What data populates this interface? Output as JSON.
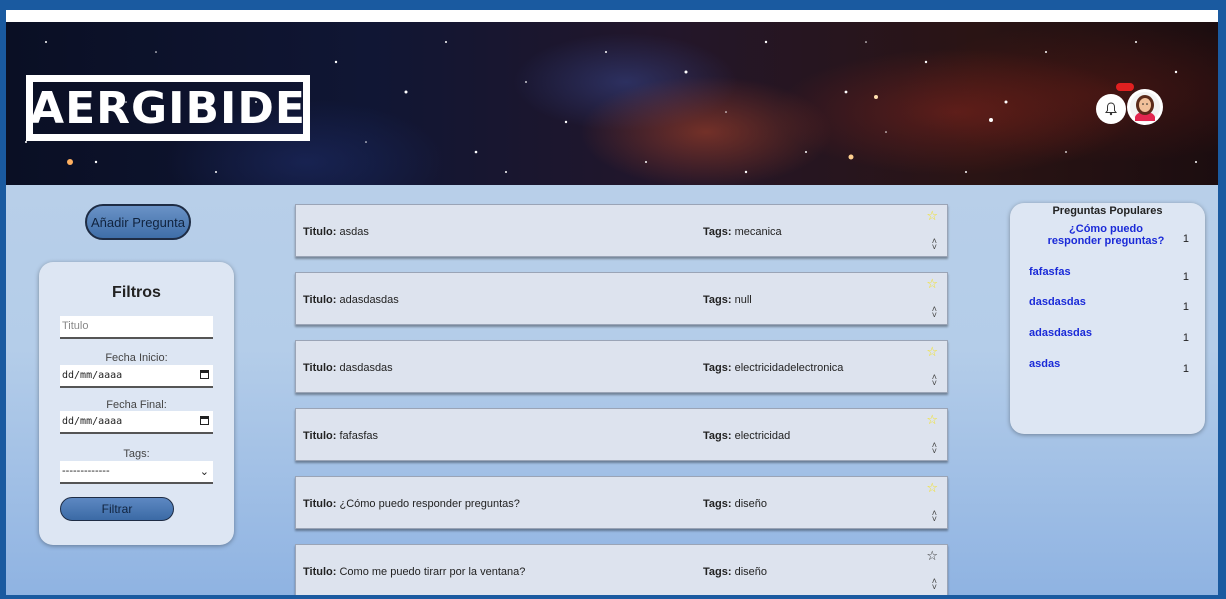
{
  "header": {
    "logo_text": "AERGIBIDE",
    "bell_icon": "bell-icon",
    "avatar_icon": "user-avatar-icon"
  },
  "sidebar": {
    "add_question_label": "Añadir Pregunta",
    "filters_title": "Filtros",
    "title_placeholder": "Titulo",
    "start_date_label": "Fecha Inicio:",
    "start_date_value": "dd/mm/aaaa",
    "end_date_label": "Fecha Final:",
    "end_date_value": "dd/mm/aaaa",
    "tags_label": "Tags:",
    "tags_selected": "-------------",
    "filter_button_label": "Filtrar"
  },
  "questions": [
    {
      "title_label": "Titulo:",
      "title": "asdas",
      "tags_label": "Tags:",
      "tags": "mecanica",
      "favorited": true
    },
    {
      "title_label": "Titulo:",
      "title": "adasdasdas",
      "tags_label": "Tags:",
      "tags": "null",
      "favorited": true
    },
    {
      "title_label": "Titulo:",
      "title": "dasdasdas",
      "tags_label": "Tags:",
      "tags": "electricidadelectronica",
      "favorited": true
    },
    {
      "title_label": "Titulo:",
      "title": "fafasfas",
      "tags_label": "Tags:",
      "tags": "electricidad",
      "favorited": true
    },
    {
      "title_label": "Titulo:",
      "title": "¿Cómo puedo responder preguntas?",
      "tags_label": "Tags:",
      "tags": "diseño",
      "favorited": true
    },
    {
      "title_label": "Titulo:",
      "title": "Como me puedo tirarr por la ventana?",
      "tags_label": "Tags:",
      "tags": "diseño",
      "favorited": false
    }
  ],
  "popular": {
    "title": "Preguntas Populares",
    "items": [
      {
        "question": "¿Cómo puedo responder preguntas?",
        "count": "1"
      },
      {
        "question": "fafasfas",
        "count": "1"
      },
      {
        "question": "dasdasdas",
        "count": "1"
      },
      {
        "question": "adasdasdas",
        "count": "1"
      },
      {
        "question": "asdas",
        "count": "1"
      }
    ]
  },
  "colors": {
    "page_border": "#1a5aa0",
    "content_bg": "#b8cfe9",
    "card_bg": "#dde3ee",
    "star_active": "#f4e220",
    "popular_link": "#1a2ad8"
  }
}
